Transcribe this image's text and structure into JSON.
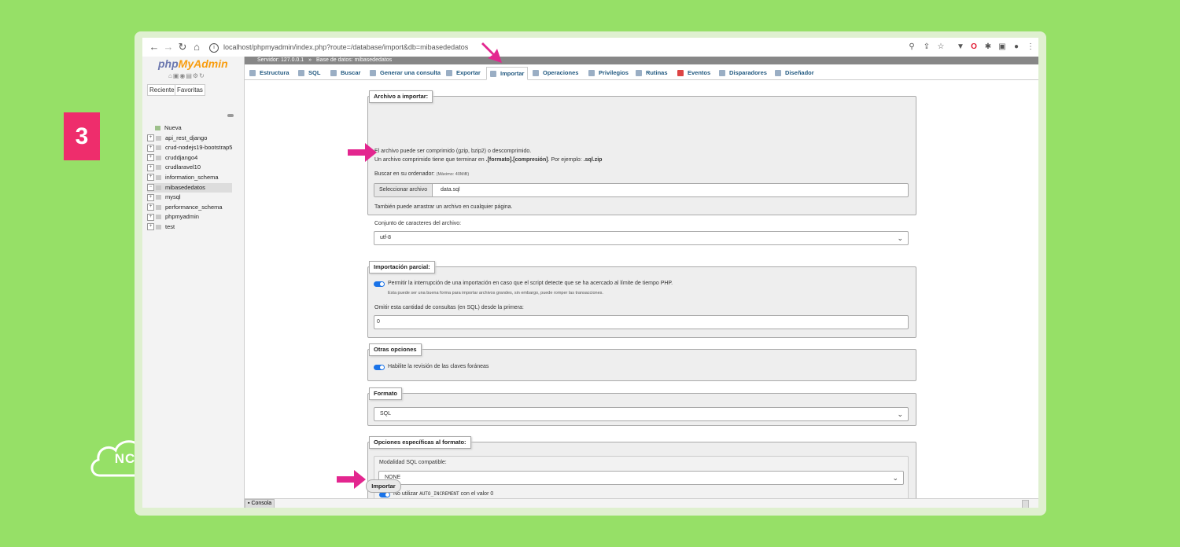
{
  "slide": {
    "step_number": "3",
    "watermark": "NC"
  },
  "browser": {
    "url": "localhost/phpmyadmin/index.php?route=/database/import&db=mibasededatos"
  },
  "sidebar": {
    "logo_php": "php",
    "logo_myadmin": "MyAdmin",
    "tabs": [
      "Reciente",
      "Favoritas"
    ],
    "new_item": "Nueva",
    "databases": [
      "api_rest_django",
      "crud-nodejs19-bootstrap5",
      "cruddjango4",
      "crudlaravel10",
      "information_schema",
      "mibasededatos",
      "mysql",
      "performance_schema",
      "phpmyadmin",
      "test"
    ],
    "selected_database": "mibasededatos"
  },
  "breadcrumb": {
    "server": "Servidor: 127.0.0.1",
    "separator": "»",
    "database": "Base de datos: mibasededatos"
  },
  "tabs": [
    "Estructura",
    "SQL",
    "Buscar",
    "Generar una consulta",
    "Exportar",
    "Importar",
    "Operaciones",
    "Privilegios",
    "Rutinas",
    "Eventos",
    "Disparadores",
    "Diseñador"
  ],
  "active_tab": "Importar",
  "import_file": {
    "legend": "Archivo a importar:",
    "desc1": "El archivo puede ser comprimido (gzip, bzip2) o descomprimido.",
    "desc2_prefix": "Un archivo comprimido tiene que terminar en ",
    "desc2_bold": ".[formato].[compresión]",
    "desc2_mid": ". Por ejemplo: ",
    "desc2_example": ".sql.zip",
    "browse_label": "Buscar en su ordenador:",
    "max_size": "(Máximo: 40MiB)",
    "select_button": "Seleccionar archivo",
    "file_name": "data.sql",
    "drag_hint": "También puede arrastrar un archivo en cualquier página.",
    "charset_label": "Conjunto de caracteres del archivo:",
    "charset_value": "utf-8"
  },
  "partial_import": {
    "legend": "Importación parcial:",
    "allow_interrupt": "Permitir la interrupción de una importación en caso que el script detecte que se ha acercado al límite de tiempo PHP.",
    "allow_interrupt_hint": "Esta puede ser una buena forma para importar archivos grandes, sin embargo, puede romper las transacciones.",
    "skip_label": "Omitir esta cantidad de consultas (en SQL) desde la primera:",
    "skip_value": "0"
  },
  "other_options": {
    "legend": "Otras opciones",
    "foreign_keys": "Habilite la revisión de las claves foráneas"
  },
  "format": {
    "legend": "Formato",
    "value": "SQL"
  },
  "format_options": {
    "legend": "Opciones específicas al formato:",
    "compat_label": "Modalidad SQL compatible:",
    "compat_value": "NONE",
    "auto_inc_prefix": "No utilizar ",
    "auto_inc_code": "AUTO_INCREMENT",
    "auto_inc_suffix": " con el valor 0"
  },
  "submit_label": "Importar",
  "console_label": "Consola",
  "colors": {
    "background": "#96e067",
    "accent_pink": "#ee2d6c",
    "toggle_blue": "#1a73e8",
    "link_blue": "#235a81"
  }
}
